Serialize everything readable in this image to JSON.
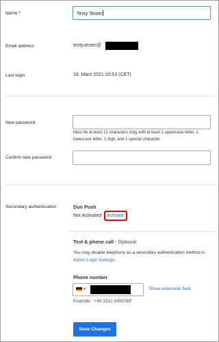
{
  "form": {
    "name_label": "Name *",
    "name_value": "Testy Tester",
    "email_label": "Email address",
    "email_value": "testy.tester@",
    "last_login_label": "Last login",
    "last_login_value": "18. März 2021 20:53 (CET)",
    "new_password_label": "New password",
    "password_hint": "Must be at least 12 characters long with at least 1 uppercase letter, 1 lowercase letter, 1 digit, and 1 special character.",
    "confirm_password_label": "Confirm new password"
  },
  "secondary": {
    "label": "Secondary authentication",
    "duo_title": "Duo Push",
    "duo_status": "Not Activated",
    "activate_link": "Activate",
    "tel_title": "Text & phone call",
    "tel_optional": " - Optional",
    "tel_desc": "You may disable telephony as a secondary authentication method in ",
    "admin_link": "Admin Login Settings",
    "tel_desc_end": ".",
    "phone_label": "Phone number",
    "extension_link": "Show extension field",
    "example": "Example: \"+49 1512 3456789\"",
    "country_caret": "▾"
  },
  "actions": {
    "save_label": "Save Changes"
  },
  "colors": {
    "accent": "#1a73e8",
    "link": "#1a6fd0",
    "highlight": "#e00000"
  }
}
